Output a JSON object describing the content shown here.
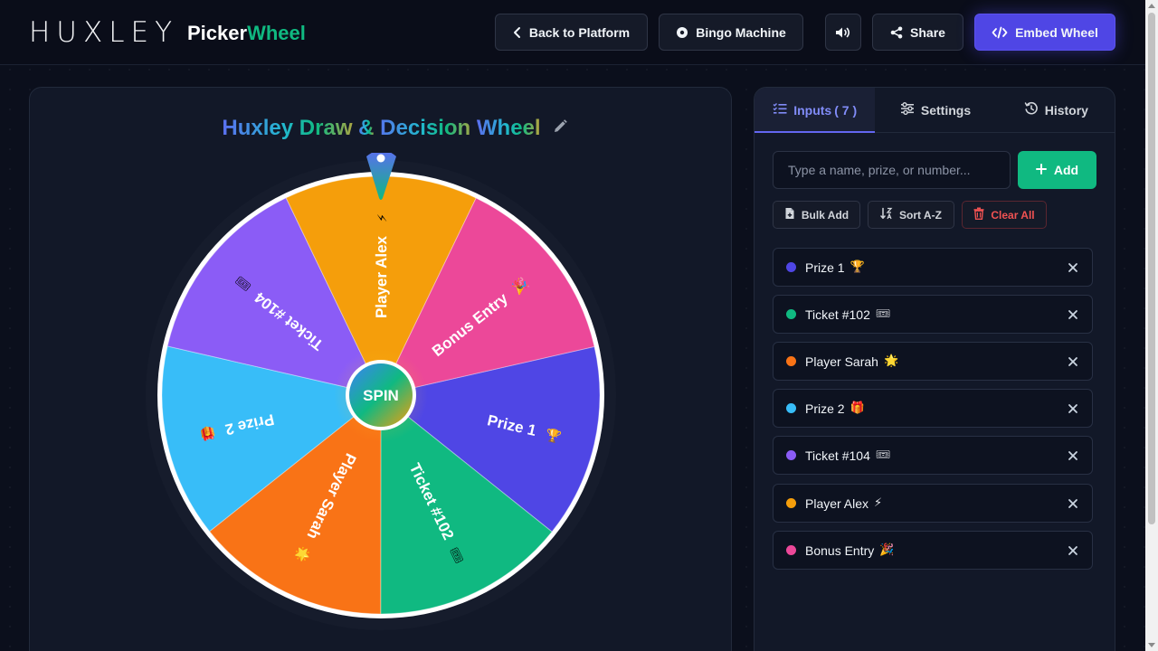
{
  "header": {
    "brand": "HUXLEY",
    "product_main": "Picker",
    "product_accent": "Wheel",
    "buttons": {
      "back": "Back to Platform",
      "bingo": "Bingo Machine",
      "share": "Share",
      "embed": "Embed Wheel"
    }
  },
  "wheel": {
    "title_parts": [
      "Huxley Draw ",
      "&",
      " Decision ",
      "Wheel"
    ],
    "spin_label": "SPIN",
    "segments": [
      {
        "label": "Prize 1",
        "emoji": "🏆",
        "color": "#4f46e5"
      },
      {
        "label": "Ticket #102",
        "emoji": "🎟",
        "color": "#10b981"
      },
      {
        "label": "Player Sarah",
        "emoji": "🌟",
        "color": "#f97316"
      },
      {
        "label": "Prize 2",
        "emoji": "🎁",
        "color": "#38bdf8"
      },
      {
        "label": "Ticket #104",
        "emoji": "🎟",
        "color": "#8b5cf6"
      },
      {
        "label": "Player Alex",
        "emoji": "⚡",
        "color": "#f59e0b"
      },
      {
        "label": "Bonus Entry",
        "emoji": "🎉",
        "color": "#ec4899"
      }
    ]
  },
  "tabs": {
    "inputs_label": "Inputs",
    "inputs_count": "( 7 )",
    "settings_label": "Settings",
    "history_label": "History"
  },
  "entry": {
    "placeholder": "Type a name, prize, or number...",
    "add_label": "Add"
  },
  "actions": {
    "bulk_add": "Bulk Add",
    "sort": "Sort A-Z",
    "clear": "Clear All"
  },
  "entries": [
    {
      "label": "Prize 1",
      "emoji": "🏆",
      "color": "#4f46e5"
    },
    {
      "label": "Ticket #102",
      "emoji": "🎟",
      "color": "#10b981"
    },
    {
      "label": "Player Sarah",
      "emoji": "🌟",
      "color": "#f97316"
    },
    {
      "label": "Prize 2",
      "emoji": "🎁",
      "color": "#38bdf8"
    },
    {
      "label": "Ticket #104",
      "emoji": "🎟",
      "color": "#8b5cf6"
    },
    {
      "label": "Player Alex",
      "emoji": "⚡",
      "color": "#f59e0b"
    },
    {
      "label": "Bonus Entry",
      "emoji": "🎉",
      "color": "#ec4899"
    }
  ]
}
